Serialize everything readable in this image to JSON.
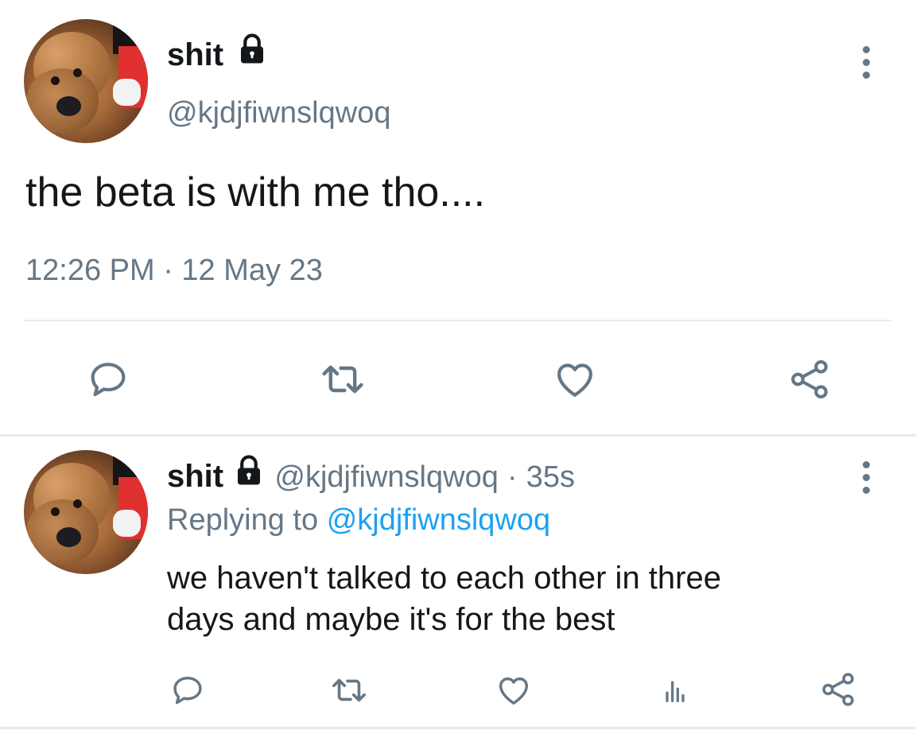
{
  "main_tweet": {
    "display_name": "shit",
    "handle": "@kjdjfiwnslqwoq",
    "text": "the beta is with me tho....",
    "timestamp": "12:26 PM · 12 May 23"
  },
  "reply_tweet": {
    "display_name": "shit",
    "handle": "@kjdjfiwnslqwoq",
    "separator": "·",
    "age": "35s",
    "replying_prefix": "Replying to",
    "replying_to": "@kjdjfiwnslqwoq",
    "text_line1": "we haven't talked to each other in three",
    "text_line2": "days and maybe it's for the best"
  },
  "icons": {
    "lock": "lock-icon",
    "more": "more-vertical-icon",
    "reply": "reply-icon",
    "retweet": "retweet-icon",
    "like": "heart-icon",
    "share": "share-icon",
    "analytics": "analytics-icon"
  },
  "colors": {
    "text": "#14171a",
    "secondary": "#657786",
    "link": "#1da1f2",
    "divider": "#e6ecf0"
  }
}
